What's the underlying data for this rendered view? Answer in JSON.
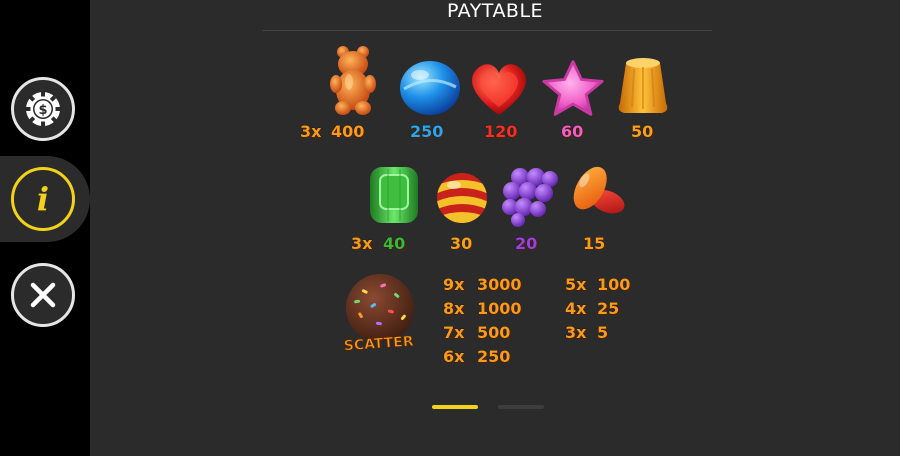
{
  "title": "PAYTABLE",
  "sidebar": {
    "buttons": [
      {
        "name": "paytable-coin-button",
        "icon": "coin-dollar-icon",
        "active": false
      },
      {
        "name": "info-button",
        "icon": "info-icon",
        "glyph": "i",
        "active": true
      },
      {
        "name": "close-button",
        "icon": "close-icon",
        "active": false
      }
    ]
  },
  "colors": {
    "active_accent": "#f2d21b",
    "payout_orange": "#f79a1e",
    "background": "#2b2b2b",
    "sidebar": "#000000"
  },
  "row1": {
    "multiplier": "3x",
    "symbols": [
      {
        "icon": "gummy-bear-icon",
        "payout": "400"
      },
      {
        "icon": "blue-candy-icon",
        "payout": "250"
      },
      {
        "icon": "red-heart-candy-icon",
        "payout": "120"
      },
      {
        "icon": "pink-star-candy-icon",
        "payout": "60"
      },
      {
        "icon": "orange-jelly-icon",
        "payout": "50"
      }
    ]
  },
  "row2": {
    "multiplier": "3x",
    "symbols": [
      {
        "icon": "green-square-candy-icon",
        "payout": "40"
      },
      {
        "icon": "striped-ball-candy-icon",
        "payout": "30"
      },
      {
        "icon": "grape-candy-icon",
        "payout": "20"
      },
      {
        "icon": "jelly-beans-icon",
        "payout": "15"
      }
    ]
  },
  "scatter": {
    "icon": "scatter-chocolate-icon",
    "label": "SCATTER",
    "payouts_left": [
      {
        "mult": "9x",
        "value": "3000"
      },
      {
        "mult": "8x",
        "value": "1000"
      },
      {
        "mult": "7x",
        "value": "500"
      },
      {
        "mult": "6x",
        "value": "250"
      }
    ],
    "payouts_right": [
      {
        "mult": "5x",
        "value": "100"
      },
      {
        "mult": "4x",
        "value": "25"
      },
      {
        "mult": "3x",
        "value": "5"
      }
    ]
  },
  "pagination": {
    "pages": 2,
    "current": 1,
    "active_color": "#f2d21b",
    "inactive_color": "#3d3d3d"
  }
}
